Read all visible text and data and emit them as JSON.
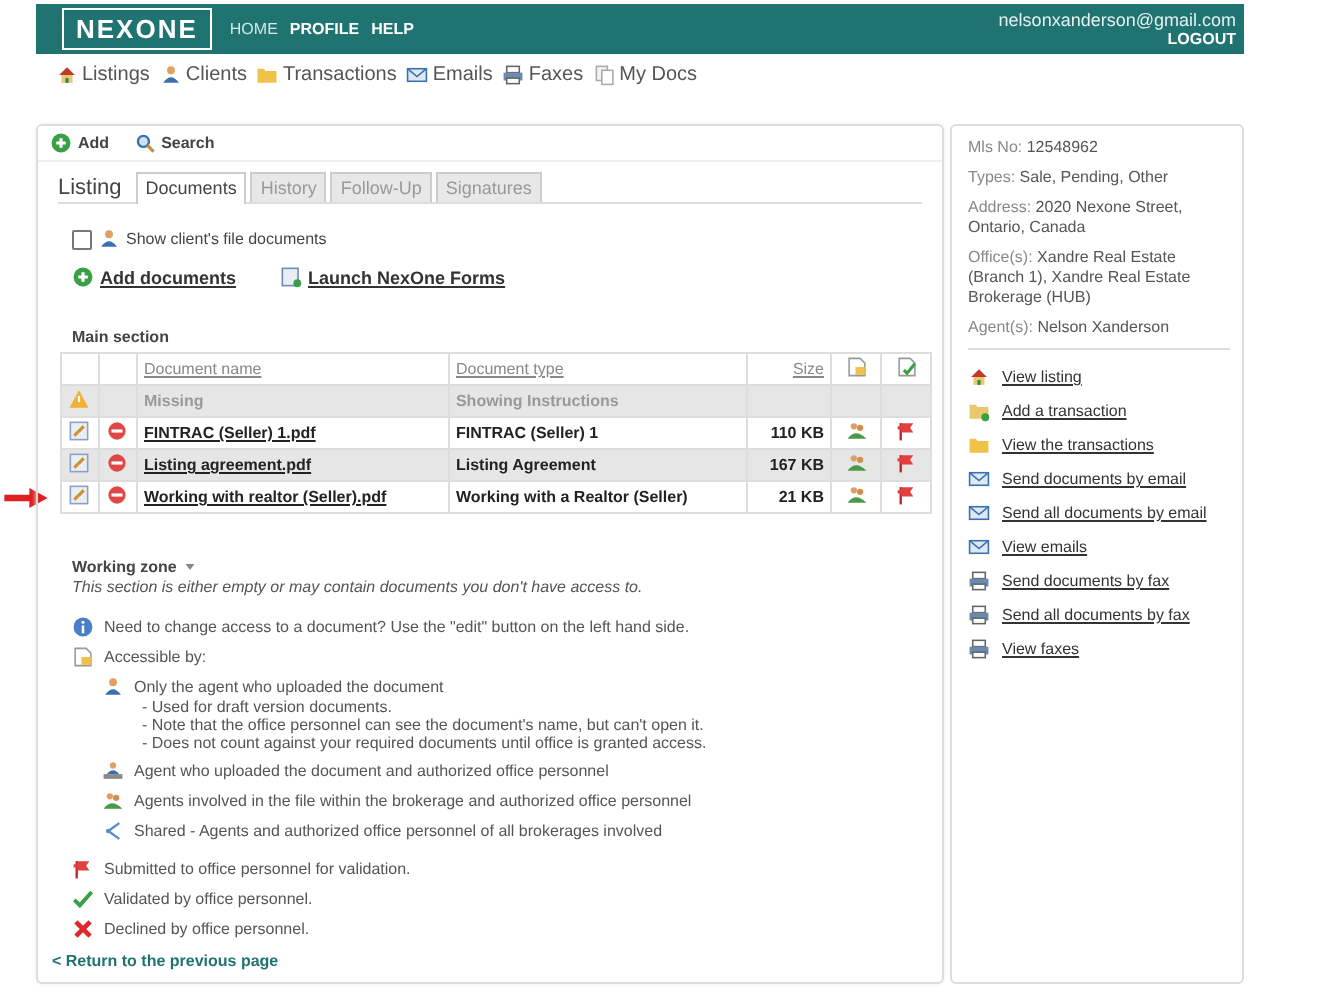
{
  "header": {
    "logo": "NEXONE",
    "nav": [
      {
        "label": "HOME",
        "selected": true
      },
      {
        "label": "PROFILE",
        "selected": false
      },
      {
        "label": "HELP",
        "selected": false
      }
    ],
    "user": "nelsonxanderson@gmail.com",
    "logout": "LOGOUT"
  },
  "toolbar": [
    {
      "kind": "house",
      "label": "Listings"
    },
    {
      "kind": "person",
      "label": "Clients"
    },
    {
      "kind": "folder",
      "label": "Transactions"
    },
    {
      "kind": "envelope",
      "label": "Emails"
    },
    {
      "kind": "printer",
      "label": "Faxes"
    },
    {
      "kind": "documents",
      "label": "My Docs"
    }
  ],
  "actions": [
    {
      "kind": "plus",
      "label": "Add"
    },
    {
      "kind": "magnifier",
      "label": "Search"
    }
  ],
  "title": "Listing",
  "tabs": [
    {
      "label": "Documents",
      "selected": true
    },
    {
      "label": "History",
      "selected": false
    },
    {
      "label": "Follow-Up",
      "selected": false
    },
    {
      "label": "Signatures",
      "selected": false
    }
  ],
  "show_client_docs": {
    "label": "Show client's file documents",
    "checked": false
  },
  "doc_links": [
    {
      "kind": "plus",
      "label": "Add documents"
    },
    {
      "kind": "form",
      "label": "Launch NexOne Forms"
    }
  ],
  "main_section": {
    "title": "Main section",
    "columns": [
      "Document name",
      "Document type",
      "Size"
    ],
    "missing": {
      "name": "Missing",
      "type": "Showing Instructions"
    },
    "rows": [
      {
        "name": "FINTRAC (Seller) 1.pdf",
        "type": "FINTRAC (Seller) 1",
        "size": "110 KB",
        "pointed": false
      },
      {
        "name": "Listing agreement.pdf",
        "type": "Listing Agreement",
        "size": "167 KB",
        "pointed": false
      },
      {
        "name": "Working with realtor (Seller).pdf",
        "type": "Working with a Realtor (Seller)",
        "size": "21 KB",
        "pointed": true
      }
    ]
  },
  "working_zone": {
    "title": "Working zone",
    "note": "This section is either empty or may contain documents you don't have access to."
  },
  "legend": [
    {
      "kind": "info",
      "text": "Need to change access to a document? Use the \"edit\" button on the left hand side."
    },
    {
      "kind": "document",
      "text": "Accessible by:",
      "children": [
        {
          "kind": "person",
          "text": "Only the agent who uploaded the document",
          "details": [
            "- Used for draft version documents.",
            "- Note that the office personnel can see the document's name, but can't open it.",
            "- Does not count against your required documents until office is granted access."
          ]
        },
        {
          "kind": "person-desk",
          "text": "Agent who uploaded the document and authorized office personnel"
        },
        {
          "kind": "people",
          "text": "Agents involved in the file within the brokerage and authorized office personnel"
        },
        {
          "kind": "share",
          "text": "Shared - Agents and authorized office personnel of all brokerages involved"
        }
      ]
    },
    {
      "kind": "flag",
      "text": "Submitted to office personnel for validation."
    },
    {
      "kind": "check",
      "text": "Validated by office personnel."
    },
    {
      "kind": "cross",
      "text": "Declined by office personnel."
    }
  ],
  "return_link": "< Return to the previous page",
  "info": [
    {
      "label": "Mls No:",
      "value": "12548962"
    },
    {
      "label": "Types:",
      "value": "Sale, Pending, Other"
    },
    {
      "label": "Address:",
      "value": "2020 Nexone Street, Ontario, Canada"
    },
    {
      "label": "Office(s):",
      "value": "Xandre Real Estate (Branch 1), Xandre Real Estate Brokerage (HUB)"
    },
    {
      "label": "Agent(s):",
      "value": "Nelson Xanderson"
    }
  ],
  "side_links": [
    {
      "kind": "house",
      "label": "View listing"
    },
    {
      "kind": "folder-plus",
      "label": "Add a transaction"
    },
    {
      "kind": "folder",
      "label": "View the transactions"
    },
    {
      "kind": "envelope",
      "label": "Send documents by email"
    },
    {
      "kind": "envelope",
      "label": "Send all documents by email"
    },
    {
      "kind": "envelope",
      "label": "View emails"
    },
    {
      "kind": "printer",
      "label": "Send documents by fax"
    },
    {
      "kind": "printer",
      "label": "Send all documents by fax"
    },
    {
      "kind": "printer",
      "label": "View faxes"
    }
  ]
}
